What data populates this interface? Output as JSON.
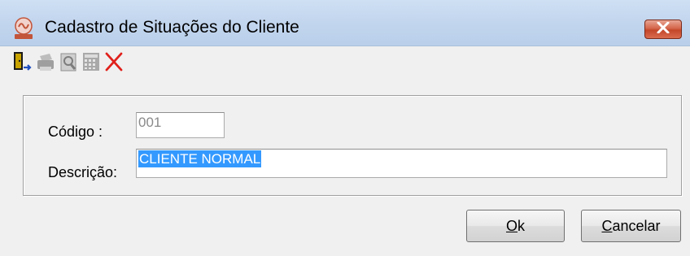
{
  "window": {
    "title": "Cadastro de Situações do Cliente",
    "close_glyph": "✕",
    "app_icon": "app-logo-icon"
  },
  "toolbar": {
    "buttons": [
      {
        "name": "exit-door-icon",
        "enabled": true
      },
      {
        "name": "printer-icon",
        "enabled": false
      },
      {
        "name": "print-preview-icon",
        "enabled": false
      },
      {
        "name": "calculator-icon",
        "enabled": false
      },
      {
        "name": "delete-x-icon",
        "enabled": true
      }
    ]
  },
  "form": {
    "codigo_label": "Código :",
    "codigo_value": "001",
    "descricao_label": "Descrição:",
    "descricao_value": "CLIENTE NORMAL"
  },
  "actions": {
    "ok_mnemonic": "O",
    "ok_rest": "k",
    "cancel_mnemonic": "C",
    "cancel_rest": "ancelar"
  },
  "colors": {
    "selection": "#3399ff",
    "delete_red": "#e0201b"
  }
}
